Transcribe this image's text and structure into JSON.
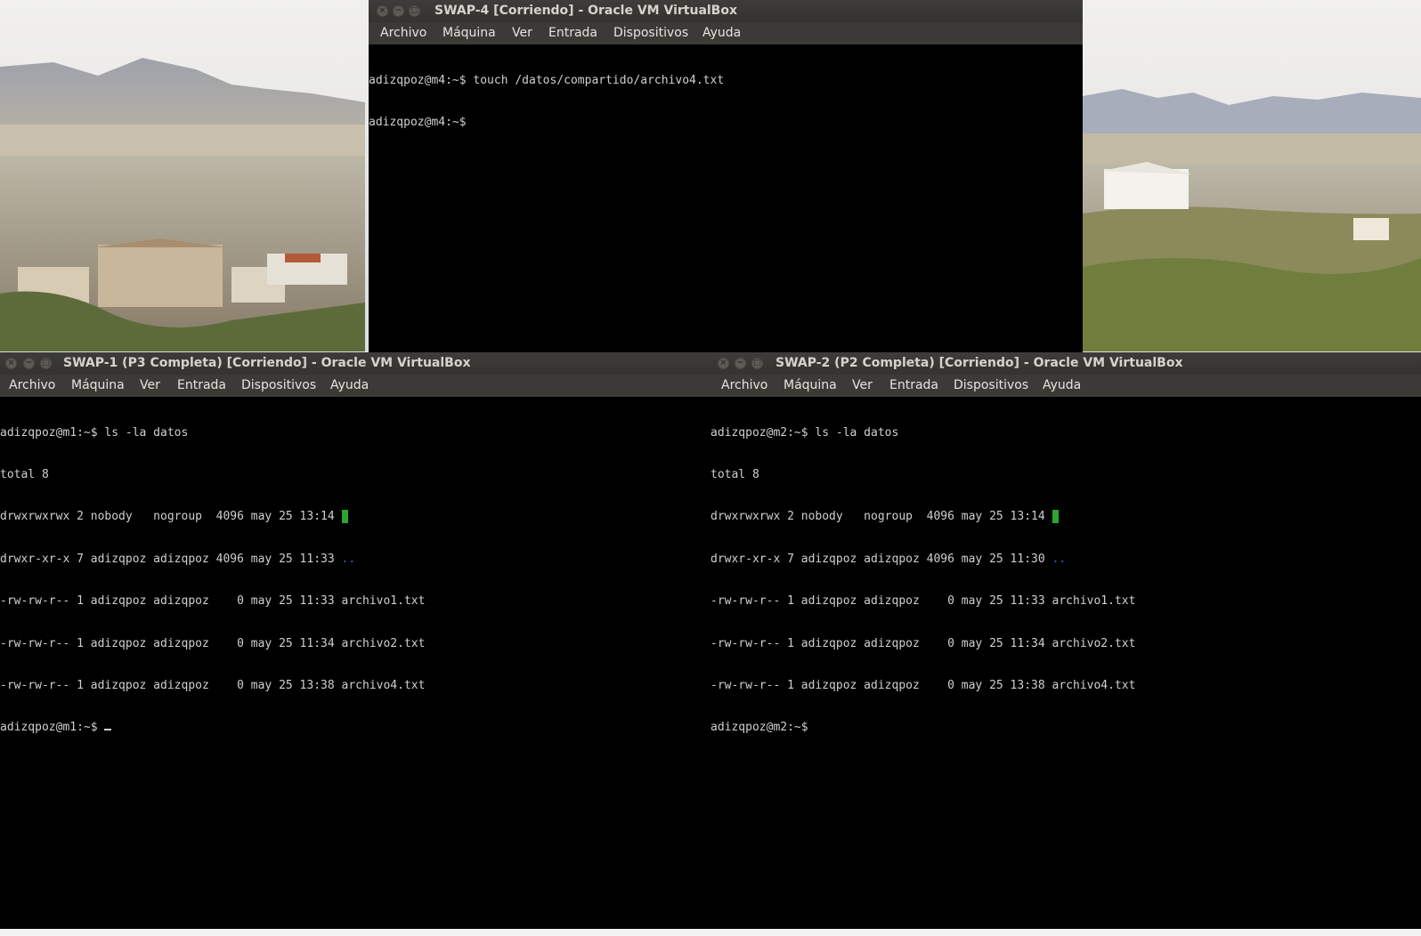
{
  "windows": {
    "swap4": {
      "title": "SWAP-4 [Corriendo] - Oracle VM VirtualBox",
      "menu": [
        "Archivo",
        "Máquina",
        "Ver",
        "Entrada",
        "Dispositivos",
        "Ayuda"
      ],
      "terminal": [
        "adizqpoz@m4:~$ touch /datos/compartido/archivo4.txt",
        "adizqpoz@m4:~$ "
      ]
    },
    "swap1": {
      "title": "SWAP-1 (P3 Completa) [Corriendo] - Oracle VM VirtualBox",
      "menu": [
        "Archivo",
        "Máquina",
        "Ver",
        "Entrada",
        "Dispositivos",
        "Ayuda"
      ],
      "terminal": {
        "cmd": "adizqpoz@m1:~$ ls -la datos",
        "total": "total 8",
        "dot_entry": "drwxrwxrwx 2 nobody   nogroup  4096 may 25 13:14 ",
        "dot_name": ".",
        "dotdot_entry": "drwxr-xr-x 7 adizqpoz adizqpoz 4096 may 25 11:33 ",
        "dotdot_name": "..",
        "files": [
          "-rw-rw-r-- 1 adizqpoz adizqpoz    0 may 25 11:33 archivo1.txt",
          "-rw-rw-r-- 1 adizqpoz adizqpoz    0 may 25 11:34 archivo2.txt",
          "-rw-rw-r-- 1 adizqpoz adizqpoz    0 may 25 13:38 archivo4.txt"
        ],
        "prompt": "adizqpoz@m1:~$ "
      }
    },
    "swap2": {
      "title": "SWAP-2 (P2 Completa) [Corriendo] - Oracle VM VirtualBox",
      "menu": [
        "Archivo",
        "Máquina",
        "Ver",
        "Entrada",
        "Dispositivos",
        "Ayuda"
      ],
      "terminal": {
        "cmd": "adizqpoz@m2:~$ ls -la datos",
        "total": "total 8",
        "dot_entry": "drwxrwxrwx 2 nobody   nogroup  4096 may 25 13:14 ",
        "dot_name": ".",
        "dotdot_entry": "drwxr-xr-x 7 adizqpoz adizqpoz 4096 may 25 11:30 ",
        "dotdot_name": "..",
        "files": [
          "-rw-rw-r-- 1 adizqpoz adizqpoz    0 may 25 11:33 archivo1.txt",
          "-rw-rw-r-- 1 adizqpoz adizqpoz    0 may 25 11:34 archivo2.txt",
          "-rw-rw-r-- 1 adizqpoz adizqpoz    0 may 25 13:38 archivo4.txt"
        ],
        "prompt": "adizqpoz@m2:~$ "
      }
    }
  },
  "colors": {
    "titlebar": "#3d3c38",
    "menubar": "#3b3a36",
    "terminal_bg": "#000000",
    "terminal_fg": "#cfcfcf",
    "dir_highlight": "#2fa32f",
    "dir_blue": "#3465d4"
  }
}
